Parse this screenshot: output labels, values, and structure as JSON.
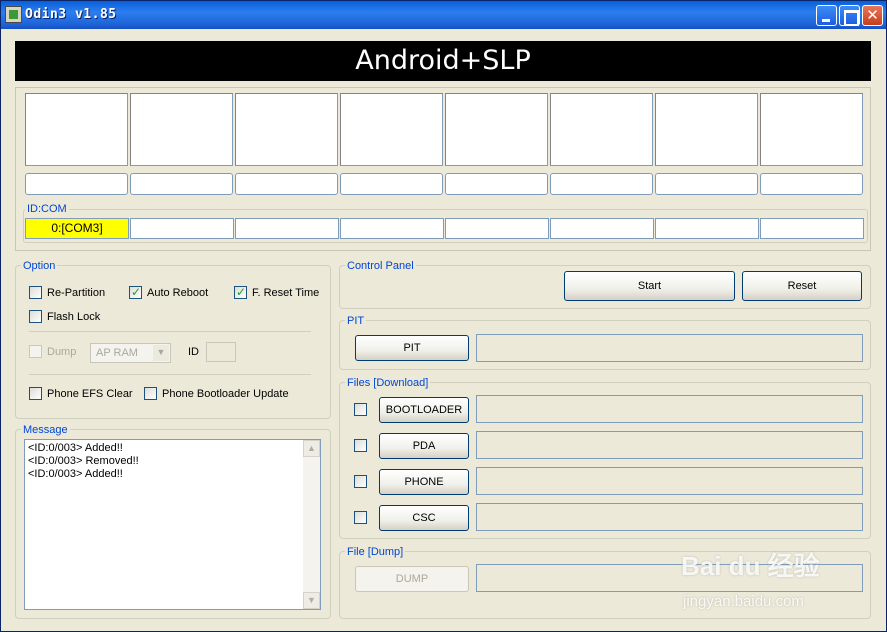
{
  "window": {
    "title": "Odin3 v1.85"
  },
  "banner": {
    "text": "Android+SLP"
  },
  "idcom": {
    "legend": "ID:COM",
    "ports": [
      "0:[COM3]",
      "",
      "",
      "",
      "",
      "",
      "",
      ""
    ]
  },
  "option": {
    "legend": "Option",
    "re_partition": {
      "label": "Re-Partition",
      "checked": false
    },
    "auto_reboot": {
      "label": "Auto Reboot",
      "checked": true
    },
    "f_reset_time": {
      "label": "F. Reset Time",
      "checked": true
    },
    "flash_lock": {
      "label": "Flash Lock",
      "checked": false
    },
    "dump": {
      "label": "Dump",
      "checked": false
    },
    "dump_target": "AP RAM",
    "id_label": "ID",
    "phone_efs_clear": {
      "label": "Phone EFS Clear",
      "checked": false
    },
    "phone_bootloader_update": {
      "label": "Phone Bootloader Update",
      "checked": false
    }
  },
  "message": {
    "legend": "Message",
    "log": "<ID:0/003> Added!!\n<ID:0/003> Removed!!\n<ID:0/003> Added!!"
  },
  "control_panel": {
    "legend": "Control Panel",
    "start_label": "Start",
    "reset_label": "Reset"
  },
  "pit": {
    "legend": "PIT",
    "button_label": "PIT"
  },
  "files_download": {
    "legend": "Files [Download]",
    "bootloader_label": "BOOTLOADER",
    "pda_label": "PDA",
    "phone_label": "PHONE",
    "csc_label": "CSC"
  },
  "file_dump": {
    "legend": "File [Dump]",
    "dump_label": "DUMP"
  },
  "watermark": {
    "text": "Bai du 经验",
    "sub": "jingyan.baidu.com"
  }
}
